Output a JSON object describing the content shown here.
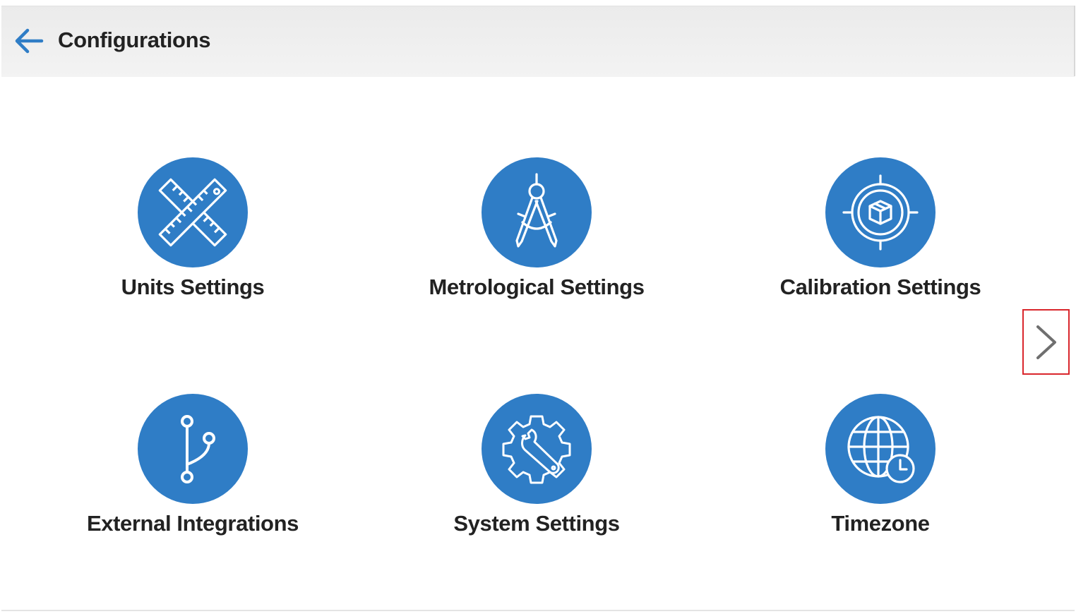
{
  "header": {
    "title": "Configurations",
    "back_icon": "arrow-left-icon"
  },
  "colors": {
    "accent": "#2f7dc6",
    "header_bg": "#efefef",
    "text": "#222222",
    "highlight_border": "#d9262c"
  },
  "tiles": [
    {
      "label": "Units Settings",
      "icon": "crossed-rulers-icon"
    },
    {
      "label": "Metrological Settings",
      "icon": "compass-drafting-icon"
    },
    {
      "label": "Calibration Settings",
      "icon": "target-box-icon"
    },
    {
      "label": "External Integrations",
      "icon": "branch-icon"
    },
    {
      "label": "System Settings",
      "icon": "gear-wrench-icon"
    },
    {
      "label": "Timezone",
      "icon": "globe-clock-icon"
    }
  ],
  "pager": {
    "next_icon": "chevron-right-icon"
  }
}
